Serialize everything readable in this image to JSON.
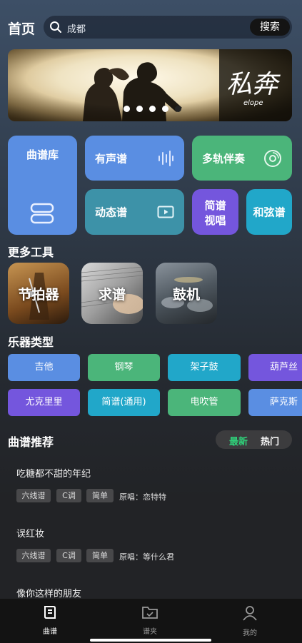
{
  "header": {
    "title": "首页",
    "search_value": "成都",
    "search_button": "搜索"
  },
  "banner": {
    "logo_text": "私奔",
    "logo_sub": "elope",
    "dots": 5
  },
  "grid": {
    "library": "曲谱库",
    "audio": "有声谱",
    "multitrack": "多轨伴奏",
    "dynamic": "动态谱",
    "jianpu_line1": "简谱",
    "jianpu_line2": "视唱",
    "chord": "和弦谱"
  },
  "tools": {
    "title": "更多工具",
    "items": [
      "节拍器",
      "求谱",
      "鼓机"
    ]
  },
  "instruments": {
    "title": "乐器类型",
    "row1": [
      "吉他",
      "钢琴",
      "架子鼓",
      "葫芦丝"
    ],
    "row2": [
      "尤克里里",
      "简谱(通用)",
      "电吹管",
      "萨克斯"
    ]
  },
  "recommend": {
    "title": "曲谱推荐",
    "tab_new": "最新",
    "tab_hot": "热门",
    "songs": [
      {
        "title": "吃糖都不甜的年纪",
        "tags": [
          "六线谱",
          "C调",
          "简单"
        ],
        "singer": "原唱：恋特特"
      },
      {
        "title": "误红妆",
        "tags": [
          "六线谱",
          "C调",
          "简单"
        ],
        "singer": "原唱：等什么君"
      },
      {
        "title": "像你这样的朋友"
      }
    ]
  },
  "tabbar": {
    "items": [
      "曲谱",
      "谱夹",
      "我的"
    ]
  },
  "colors": {
    "accent_green": "#2fd27a",
    "blue": "#5a8ee2",
    "green": "#4bb57a",
    "cyan": "#21a7c9",
    "purple": "#7456dd"
  }
}
